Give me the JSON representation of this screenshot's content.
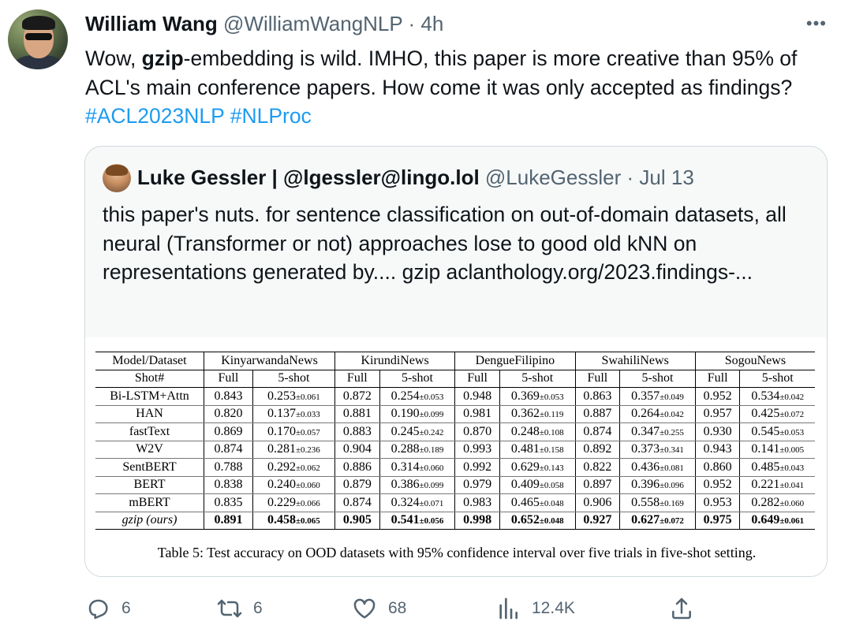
{
  "tweet": {
    "author_name": "William Wang",
    "author_handle": "@WilliamWangNLP",
    "separator": "·",
    "time": "4h",
    "more": "•••",
    "text_before_bold": "Wow, ",
    "text_bold": "gzip",
    "text_after_bold": "-embedding is wild. IMHO, this paper is more creative than 95% of ACL's main conference papers. How come it was only accepted as findings?  ",
    "hashtags": [
      "#ACL2023NLP",
      "#NLProc"
    ]
  },
  "quote": {
    "author_name": "Luke Gessler | @lgessler@lingo.lol",
    "author_handle": "@LukeGessler",
    "separator": "·",
    "time": "Jul 13",
    "text": "this paper's nuts. for sentence classification on out-of-domain datasets, all neural (Transformer or not) approaches lose to good old kNN on representations generated by.... gzip aclanthology.org/2023.findings-..."
  },
  "table": {
    "header_label": "Model/Dataset",
    "datasets": [
      "KinyarwandaNews",
      "KirundiNews",
      "DengueFilipino",
      "SwahiliNews",
      "SogouNews"
    ],
    "shot_label": "Shot#",
    "shot_full": "Full",
    "shot_5": "5-shot",
    "rows": [
      {
        "model": "Bi-LSTM+Attn",
        "cells": [
          [
            "0.843",
            "0.253",
            "±0.061"
          ],
          [
            "0.872",
            "0.254",
            "±0.053"
          ],
          [
            "0.948",
            "0.369",
            "±0.053"
          ],
          [
            "0.863",
            "0.357",
            "±0.049"
          ],
          [
            "0.952",
            "0.534",
            "±0.042"
          ]
        ]
      },
      {
        "model": "HAN",
        "cells": [
          [
            "0.820",
            "0.137",
            "±0.033"
          ],
          [
            "0.881",
            "0.190",
            "±0.099"
          ],
          [
            "0.981",
            "0.362",
            "±0.119"
          ],
          [
            "0.887",
            "0.264",
            "±0.042"
          ],
          [
            "0.957",
            "0.425",
            "±0.072"
          ]
        ]
      },
      {
        "model": "fastText",
        "cells": [
          [
            "0.869",
            "0.170",
            "±0.057"
          ],
          [
            "0.883",
            "0.245",
            "±0.242"
          ],
          [
            "0.870",
            "0.248",
            "±0.108"
          ],
          [
            "0.874",
            "0.347",
            "±0.255"
          ],
          [
            "0.930",
            "0.545",
            "±0.053"
          ]
        ]
      },
      {
        "model": "W2V",
        "cells": [
          [
            "0.874",
            "0.281",
            "±0.236"
          ],
          [
            "0.904",
            "0.288",
            "±0.189"
          ],
          [
            "0.993",
            "0.481",
            "±0.158"
          ],
          [
            "0.892",
            "0.373",
            "±0.341"
          ],
          [
            "0.943",
            "0.141",
            "±0.005"
          ]
        ]
      },
      {
        "model": "SentBERT",
        "cells": [
          [
            "0.788",
            "0.292",
            "±0.062"
          ],
          [
            "0.886",
            "0.314",
            "±0.060"
          ],
          [
            "0.992",
            "0.629",
            "±0.143"
          ],
          [
            "0.822",
            "0.436",
            "±0.081"
          ],
          [
            "0.860",
            "0.485",
            "±0.043"
          ]
        ]
      },
      {
        "model": "BERT",
        "cells": [
          [
            "0.838",
            "0.240",
            "±0.060"
          ],
          [
            "0.879",
            "0.386",
            "±0.099"
          ],
          [
            "0.979",
            "0.409",
            "±0.058"
          ],
          [
            "0.897",
            "0.396",
            "±0.096"
          ],
          [
            "0.952",
            "0.221",
            "±0.041"
          ]
        ]
      },
      {
        "model": "mBERT",
        "cells": [
          [
            "0.835",
            "0.229",
            "±0.066"
          ],
          [
            "0.874",
            "0.324",
            "±0.071"
          ],
          [
            "0.983",
            "0.465",
            "±0.048"
          ],
          [
            "0.906",
            "0.558",
            "±0.169"
          ],
          [
            "0.953",
            "0.282",
            "±0.060"
          ]
        ]
      },
      {
        "model": "gzip (ours)",
        "cells": [
          [
            "0.891",
            "0.458",
            "±0.065"
          ],
          [
            "0.905",
            "0.541",
            "±0.056"
          ],
          [
            "0.998",
            "0.652",
            "±0.048"
          ],
          [
            "0.927",
            "0.627",
            "±0.072"
          ],
          [
            "0.975",
            "0.649",
            "±0.061"
          ]
        ]
      }
    ],
    "caption": "Table 5: Test accuracy on OOD datasets with 95% confidence interval over five trials in five-shot setting."
  },
  "actions": {
    "replies": "6",
    "retweets": "6",
    "likes": "68",
    "views": "12.4K"
  },
  "colors": {
    "text": "#0f1419",
    "secondary": "#536471",
    "link": "#1d9bf0",
    "border": "#cfd9de",
    "card_bg": "#f7f9f9"
  }
}
